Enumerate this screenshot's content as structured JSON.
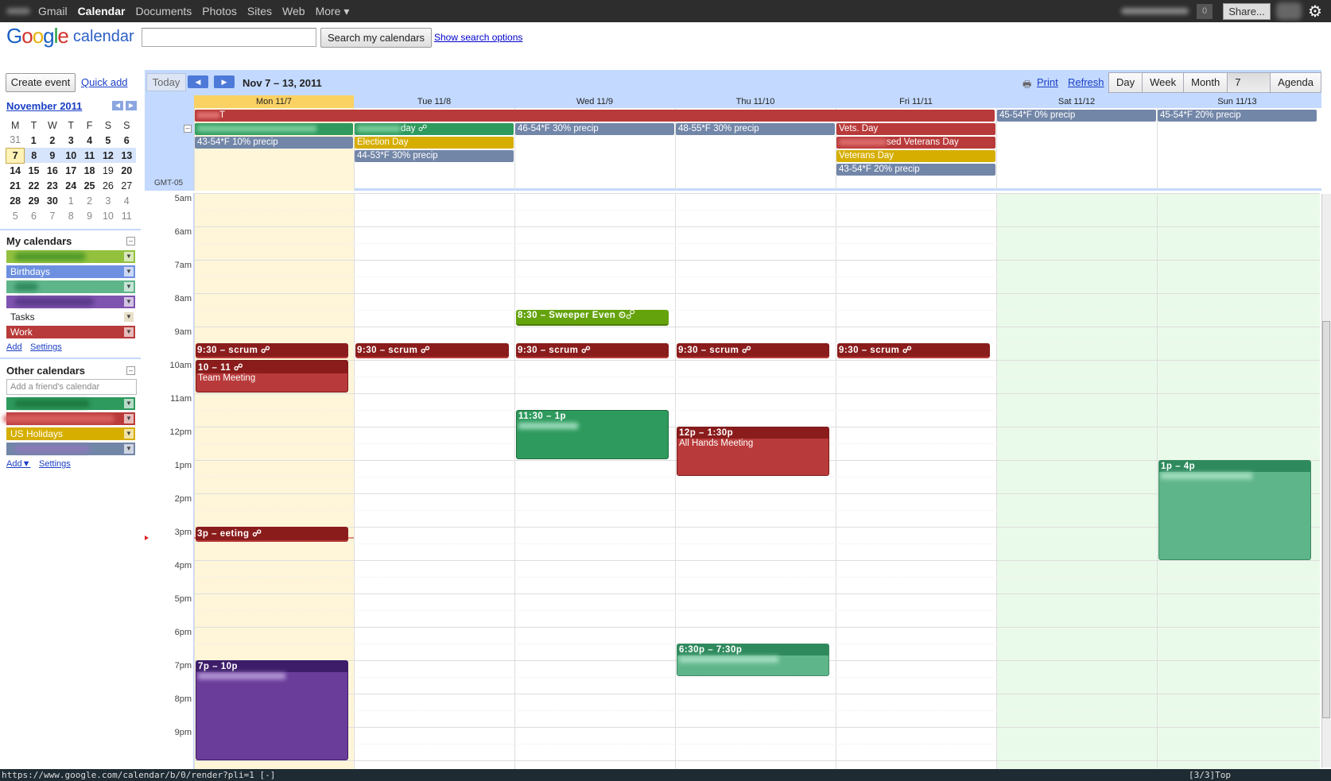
{
  "topbar": {
    "nav": [
      "Gmail",
      "Calendar",
      "Documents",
      "Photos",
      "Sites",
      "Web",
      "More ▾"
    ],
    "active": "Calendar",
    "notification_count": "0",
    "share_label": "Share..."
  },
  "header": {
    "logo_text": "Google",
    "logo_sub": "calendar",
    "search_button": "Search my calendars",
    "search_options": "Show search options"
  },
  "sidebar": {
    "create_event": "Create event",
    "quick_add": "Quick add",
    "mini_month": "November 2011",
    "weekdays": [
      "M",
      "T",
      "W",
      "T",
      "F",
      "S",
      "S"
    ],
    "weeks": [
      [
        "31",
        "1",
        "2",
        "3",
        "4",
        "5",
        "6"
      ],
      [
        "7",
        "8",
        "9",
        "10",
        "11",
        "12",
        "13"
      ],
      [
        "14",
        "15",
        "16",
        "17",
        "18",
        "19",
        "20"
      ],
      [
        "21",
        "22",
        "23",
        "24",
        "25",
        "26",
        "27"
      ],
      [
        "28",
        "29",
        "30",
        "1",
        "2",
        "3",
        "4"
      ],
      [
        "5",
        "6",
        "7",
        "8",
        "9",
        "10",
        "11"
      ]
    ],
    "my_calendars_title": "My calendars",
    "my_calendars": [
      {
        "label": "",
        "color": "#92c13e"
      },
      {
        "label": "Birthdays",
        "color": "#6d90e0"
      },
      {
        "label": "",
        "color": "#5fb58a"
      },
      {
        "label": "",
        "color": "#7f53b0"
      },
      {
        "label": "Tasks",
        "color": "#ffffff"
      },
      {
        "label": "Work",
        "color": "#b93a3a"
      }
    ],
    "add": "Add",
    "settings": "Settings",
    "other_calendars_title": "Other calendars",
    "friend_placeholder": "Add a friend's calendar",
    "other_calendars": [
      {
        "label": "",
        "color": "#2e9a5d"
      },
      {
        "label": "",
        "color": "#b93a3a"
      },
      {
        "label": "US Holidays",
        "color": "#d6ae00"
      },
      {
        "label": "",
        "color": "#7286a8"
      }
    ],
    "add2": "Add▼",
    "settings2": "Settings"
  },
  "toolbar": {
    "today": "Today",
    "prev": "◀",
    "next": "▶",
    "range": "Nov 7 – 13, 2011",
    "print": "Print",
    "refresh": "Refresh",
    "views": [
      "Day",
      "Week",
      "Month",
      "7 Days",
      "Agenda"
    ],
    "selected_view": "7 Days"
  },
  "grid": {
    "timezone": "GMT-05",
    "days": [
      "Mon 11/7",
      "Tue 11/8",
      "Wed 11/9",
      "Thu 11/10",
      "Fri 11/11",
      "Sat 11/12",
      "Sun 11/13"
    ],
    "hours": [
      "5am",
      "6am",
      "7am",
      "8am",
      "9am",
      "10am",
      "11am",
      "12pm",
      "1pm",
      "2pm",
      "3pm",
      "4pm",
      "5pm",
      "6pm",
      "7pm",
      "8pm",
      "9pm"
    ],
    "allday": [
      {
        "text": "T",
        "color": "#b93a3a"
      },
      {
        "text": "45-54*F 0% precip",
        "color": "#7286a8"
      },
      {
        "text": "45-54*F 20% precip",
        "color": "#7286a8"
      },
      {
        "text": "",
        "color": "#2e9a5d"
      },
      {
        "text": "day ☍",
        "color": "#2e9a5d"
      },
      {
        "text": "46-54*F 30% precip",
        "color": "#7286a8"
      },
      {
        "text": "48-55*F 30% precip",
        "color": "#7286a8"
      },
      {
        "text": "Vets. Day",
        "color": "#b93a3a"
      },
      {
        "text": "43-54*F 10% precip",
        "color": "#7286a8"
      },
      {
        "text": "Election Day",
        "color": "#d6ae00"
      },
      {
        "text": "sed Veterans Day",
        "color": "#b93a3a"
      },
      {
        "text": "44-53*F 30% precip",
        "color": "#7286a8"
      },
      {
        "text": "Veterans Day",
        "color": "#d6ae00"
      },
      {
        "text": "43-54*F 20% precip",
        "color": "#7286a8"
      }
    ],
    "events": [
      {
        "time": "8:30 – Sweeper Even ⏲☍",
        "desc": "",
        "color": "#65a30d"
      },
      {
        "time": "9:30 – scrum ☍",
        "desc": "",
        "color": "#8a1c1c"
      },
      {
        "time": "9:30 – scrum ☍",
        "desc": "",
        "color": "#8a1c1c"
      },
      {
        "time": "9:30 – scrum ☍",
        "desc": "",
        "color": "#8a1c1c"
      },
      {
        "time": "9:30 – scrum ☍",
        "desc": "",
        "color": "#8a1c1c"
      },
      {
        "time": "9:30 – scrum ☍",
        "desc": "",
        "color": "#8a1c1c"
      },
      {
        "time": "10 – 11 ☍",
        "desc": "Team Meeting",
        "color": "#b93a3a"
      },
      {
        "time": "11:30 – 1p",
        "desc": "",
        "color": "#2e9a5d"
      },
      {
        "time": "12p – 1:30p",
        "desc": "All Hands Meeting",
        "color": "#b93a3a"
      },
      {
        "time": "1p – 4p",
        "desc": "",
        "color": "#5fb58a"
      },
      {
        "time": "3p – eeting ☍",
        "desc": "",
        "color": "#8a1c1c"
      },
      {
        "time": "6:30p – 7:30p",
        "desc": "",
        "color": "#5fb58a"
      },
      {
        "time": "7p – 10p",
        "desc": "",
        "color": "#6a3d9a"
      }
    ]
  },
  "statusbar": {
    "url": "https://www.google.com/calendar/b/0/render?pli=1 [-]",
    "right": "[3/3]Top"
  }
}
